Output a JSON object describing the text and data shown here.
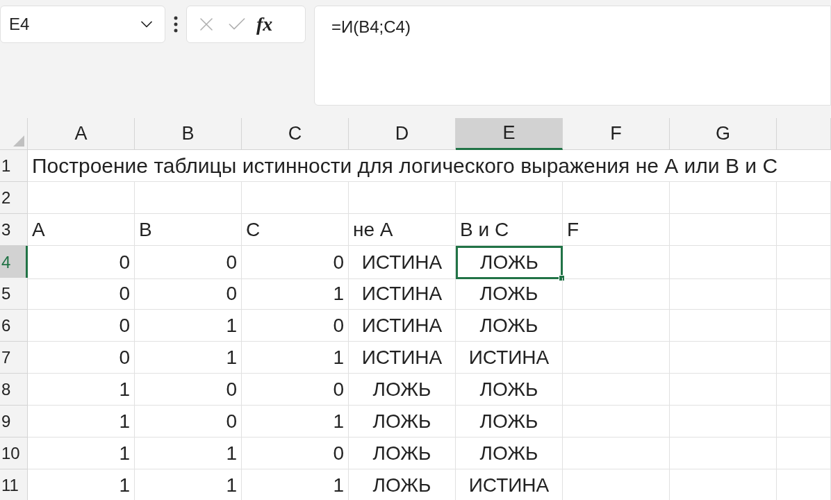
{
  "name_box": {
    "value": "E4"
  },
  "formula_bar": {
    "fx_label": "fx",
    "value": "=И(B4;C4)"
  },
  "columns": [
    {
      "label": "A",
      "selected": false
    },
    {
      "label": "B",
      "selected": false
    },
    {
      "label": "C",
      "selected": false
    },
    {
      "label": "D",
      "selected": false
    },
    {
      "label": "E",
      "selected": true
    },
    {
      "label": "F",
      "selected": false
    },
    {
      "label": "G",
      "selected": false
    },
    {
      "selected": false
    }
  ],
  "title_row": {
    "number": "1",
    "text": "Построение таблицы истинности для логического выражения не А или B и С"
  },
  "rows": [
    {
      "number": "2",
      "selected": false,
      "cells": []
    },
    {
      "number": "3",
      "selected": false,
      "cells": [
        {
          "kind": "text",
          "value": "A"
        },
        {
          "kind": "text",
          "value": "B"
        },
        {
          "kind": "text",
          "value": "C"
        },
        {
          "kind": "text",
          "value": "не А"
        },
        {
          "kind": "text",
          "value": "В и С"
        },
        {
          "kind": "text",
          "value": "F"
        }
      ]
    },
    {
      "number": "4",
      "selected": true,
      "cells": [
        {
          "kind": "number",
          "value": "0"
        },
        {
          "kind": "number",
          "value": "0"
        },
        {
          "kind": "number",
          "value": "0"
        },
        {
          "kind": "bool",
          "value": "ИСТИНА"
        },
        {
          "kind": "bool",
          "value": "ЛОЖЬ",
          "selected": true
        }
      ]
    },
    {
      "number": "5",
      "selected": false,
      "cells": [
        {
          "kind": "number",
          "value": "0"
        },
        {
          "kind": "number",
          "value": "0"
        },
        {
          "kind": "number",
          "value": "1"
        },
        {
          "kind": "bool",
          "value": "ИСТИНА"
        },
        {
          "kind": "bool",
          "value": "ЛОЖЬ"
        }
      ]
    },
    {
      "number": "6",
      "selected": false,
      "cells": [
        {
          "kind": "number",
          "value": "0"
        },
        {
          "kind": "number",
          "value": "1"
        },
        {
          "kind": "number",
          "value": "0"
        },
        {
          "kind": "bool",
          "value": "ИСТИНА"
        },
        {
          "kind": "bool",
          "value": "ЛОЖЬ"
        }
      ]
    },
    {
      "number": "7",
      "selected": false,
      "cells": [
        {
          "kind": "number",
          "value": "0"
        },
        {
          "kind": "number",
          "value": "1"
        },
        {
          "kind": "number",
          "value": "1"
        },
        {
          "kind": "bool",
          "value": "ИСТИНА"
        },
        {
          "kind": "bool",
          "value": "ИСТИНА"
        }
      ]
    },
    {
      "number": "8",
      "selected": false,
      "cells": [
        {
          "kind": "number",
          "value": "1"
        },
        {
          "kind": "number",
          "value": "0"
        },
        {
          "kind": "number",
          "value": "0"
        },
        {
          "kind": "bool",
          "value": "ЛОЖЬ"
        },
        {
          "kind": "bool",
          "value": "ЛОЖЬ"
        }
      ]
    },
    {
      "number": "9",
      "selected": false,
      "cells": [
        {
          "kind": "number",
          "value": "1"
        },
        {
          "kind": "number",
          "value": "0"
        },
        {
          "kind": "number",
          "value": "1"
        },
        {
          "kind": "bool",
          "value": "ЛОЖЬ"
        },
        {
          "kind": "bool",
          "value": "ЛОЖЬ"
        }
      ]
    },
    {
      "number": "10",
      "selected": false,
      "cells": [
        {
          "kind": "number",
          "value": "1"
        },
        {
          "kind": "number",
          "value": "1"
        },
        {
          "kind": "number",
          "value": "0"
        },
        {
          "kind": "bool",
          "value": "ЛОЖЬ"
        },
        {
          "kind": "bool",
          "value": "ЛОЖЬ"
        }
      ]
    },
    {
      "number": "11",
      "selected": false,
      "cells": [
        {
          "kind": "number",
          "value": "1"
        },
        {
          "kind": "number",
          "value": "1"
        },
        {
          "kind": "number",
          "value": "1"
        },
        {
          "kind": "bool",
          "value": "ЛОЖЬ"
        },
        {
          "kind": "bool",
          "value": "ИСТИНА"
        }
      ]
    }
  ]
}
